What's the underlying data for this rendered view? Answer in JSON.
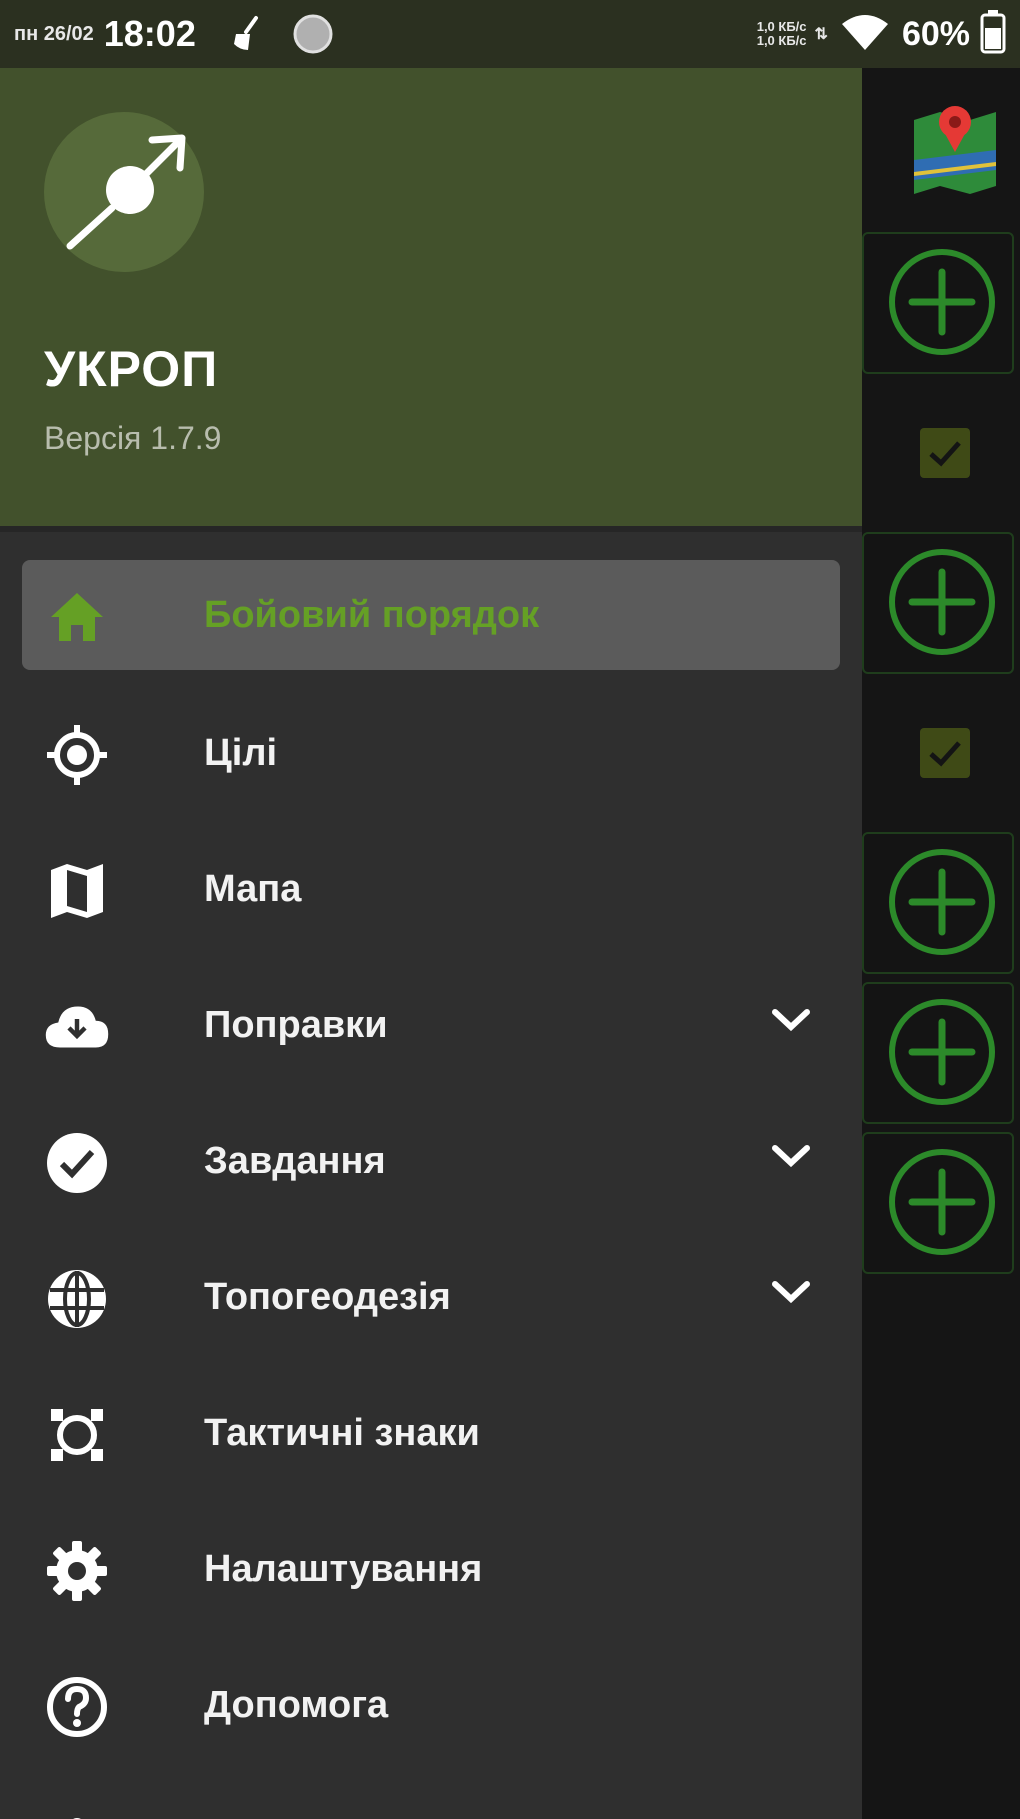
{
  "status_bar": {
    "date": "пн 26/02",
    "time": "18:02",
    "net_up": "1,0 КБ/с",
    "net_down": "1,0 КБ/с",
    "battery": "60%"
  },
  "drawer": {
    "app_name": "УКРОП",
    "version": "Версія 1.7.9",
    "menu": [
      {
        "label": "Бойовий порядок",
        "icon": "home-icon",
        "active": true
      },
      {
        "label": "Цілі",
        "icon": "crosshair-icon"
      },
      {
        "label": "Мапа",
        "icon": "map-icon"
      },
      {
        "label": "Поправки",
        "icon": "cloud-download-icon",
        "expandable": true
      },
      {
        "label": "Завдання",
        "icon": "check-circle-icon",
        "expandable": true
      },
      {
        "label": "Топогеодезія",
        "icon": "globe-icon",
        "expandable": true
      },
      {
        "label": "Тактичні знаки",
        "icon": "tactical-sign-icon"
      },
      {
        "label": "Налаштування",
        "icon": "gear-icon"
      },
      {
        "label": "Допомога",
        "icon": "help-icon"
      }
    ]
  },
  "colors": {
    "header_bg": "#42512c",
    "drawer_bg": "#2f2f2f",
    "active_item_bg": "#5b5b5b",
    "accent_green": "#65a025",
    "side_panel_bg": "#151515"
  }
}
